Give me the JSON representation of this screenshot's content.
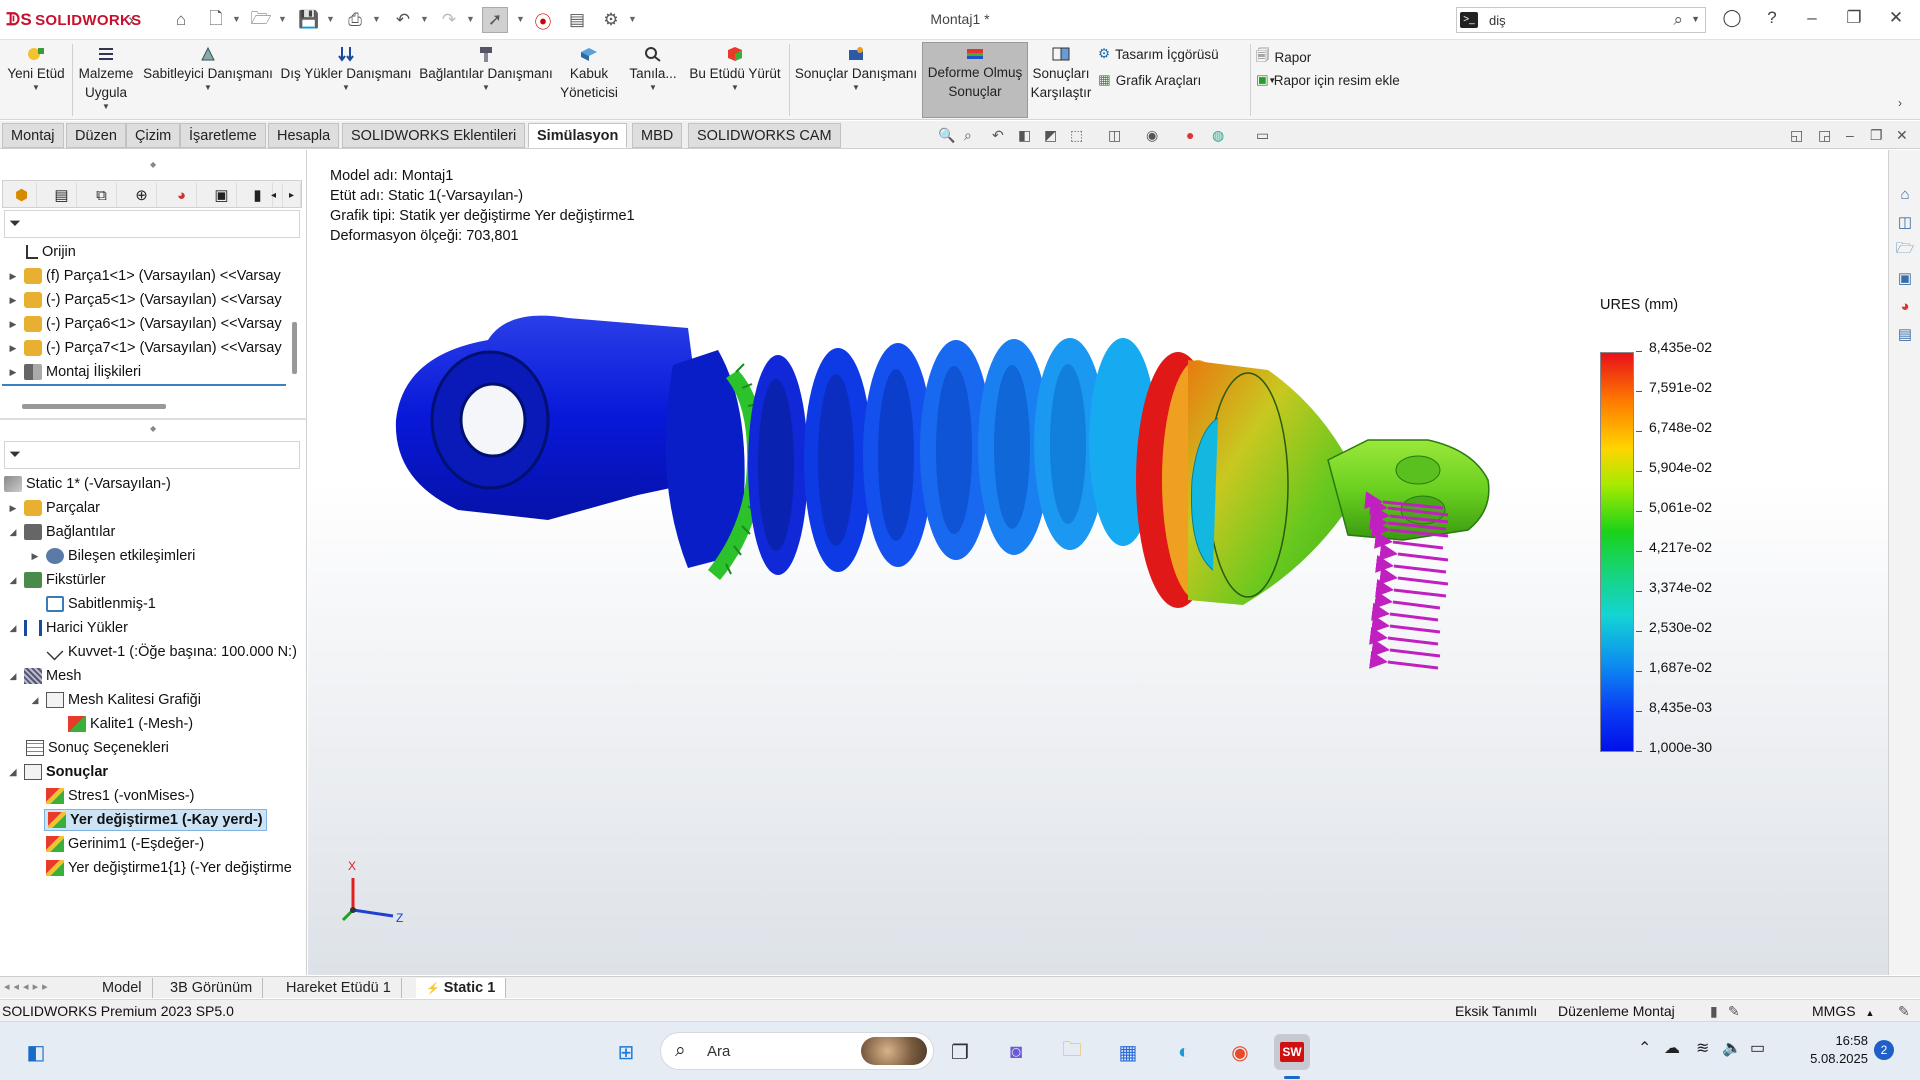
{
  "app": {
    "brand": "SOLIDWORKS",
    "window_title": "Montaj1 *",
    "search": {
      "value": "diş"
    }
  },
  "ribbon": {
    "buttons": [
      {
        "label": "Yeni Etüd",
        "icon": "new-study-icon"
      },
      {
        "label": "Malzeme Uygula",
        "icon": "apply-material-icon"
      },
      {
        "label": "Sabitleyici Danışmanı",
        "icon": "fixture-advisor-icon"
      },
      {
        "label": "Dış Yükler Danışmanı",
        "icon": "external-loads-icon"
      },
      {
        "label": "Bağlantılar Danışmanı",
        "icon": "connections-icon"
      },
      {
        "label": "Kabuk Yöneticisi",
        "icon": "shell-manager-icon"
      },
      {
        "label": "Tanıla...",
        "icon": "diagnose-icon"
      },
      {
        "label": "Bu Etüdü Yürüt",
        "icon": "run-study-icon"
      },
      {
        "label": "Sonuçlar Danışmanı",
        "icon": "results-advisor-icon"
      },
      {
        "label": "Deforme Olmuş Sonuçlar",
        "icon": "deformed-result-icon"
      },
      {
        "label": "Sonuçları Karşılaştır",
        "icon": "compare-results-icon"
      }
    ],
    "small": {
      "design_insight": "Tasarım İçgörüsü",
      "plot_tools": "Grafik Araçları",
      "report": "Rapor",
      "add_image": "Rapor için resim ekle"
    }
  },
  "command_tabs": [
    "Montaj",
    "Düzen",
    "Çizim",
    "İşaretleme",
    "Hesapla",
    "SOLIDWORKS Eklentileri",
    "Simülasyon",
    "MBD",
    "SOLIDWORKS CAM"
  ],
  "active_command_tab": "Simülasyon",
  "feature_tree": {
    "items": [
      {
        "label": "Orijin"
      },
      {
        "label": "(f) Parça1<1> (Varsayılan) <<Varsay"
      },
      {
        "label": "(-) Parça5<1> (Varsayılan) <<Varsay"
      },
      {
        "label": "(-) Parça6<1> (Varsayılan) <<Varsay"
      },
      {
        "label": "(-) Parça7<1> (Varsayılan) <<Varsay"
      },
      {
        "label": "Montaj İlişkileri"
      }
    ]
  },
  "sim_tree": {
    "items": [
      {
        "label": "Static 1* (-Varsayılan-)"
      },
      {
        "label": "Parçalar"
      },
      {
        "label": "Bağlantılar"
      },
      {
        "label": "Bileşen etkileşimleri"
      },
      {
        "label": "Fikstürler"
      },
      {
        "label": "Sabitlenmiş-1"
      },
      {
        "label": "Harici Yükler"
      },
      {
        "label": "Kuvvet-1 (:Öğe başına: 100.000 N:)"
      },
      {
        "label": "Mesh"
      },
      {
        "label": "Mesh Kalitesi Grafiği"
      },
      {
        "label": "Kalite1 (-Mesh-)"
      },
      {
        "label": "Sonuç Seçenekleri"
      },
      {
        "label": "Sonuçlar"
      },
      {
        "label": "Stres1 (-vonMises-)"
      },
      {
        "label": "Yer değiştirme1 (-Kay yerd-)"
      },
      {
        "label": "Gerinim1 (-Eşdeğer-)"
      },
      {
        "label": "Yer değiştirme1{1} (-Yer değiştirme"
      }
    ]
  },
  "viewport": {
    "info": [
      "Model adı: Montaj1",
      "Etüt adı: Static 1(-Varsayılan-)",
      "Grafik tipi: Statik yer değiştirme Yer değiştirme1",
      "Deformasyon ölçeği: 703,801"
    ],
    "legend": {
      "title": "URES (mm)",
      "values": [
        "8,435e-02",
        "7,591e-02",
        "6,748e-02",
        "5,904e-02",
        "5,061e-02",
        "4,217e-02",
        "3,374e-02",
        "2,530e-02",
        "1,687e-02",
        "8,435e-03",
        "1,000e-30"
      ]
    },
    "triad": {
      "x": "X",
      "z": "Z"
    }
  },
  "bottom_tabs": [
    "Model",
    "3B Görünüm",
    "Hareket Etüdü 1",
    "Static 1"
  ],
  "status": {
    "version": "SOLIDWORKS Premium 2023 SP5.0",
    "definition": "Eksik Tanımlı",
    "mode": "Düzenleme Montaj",
    "units": "MMGS"
  },
  "taskbar": {
    "search_label": "Ara",
    "time": "16:58",
    "date": "5.08.2025",
    "notifications": "2"
  }
}
